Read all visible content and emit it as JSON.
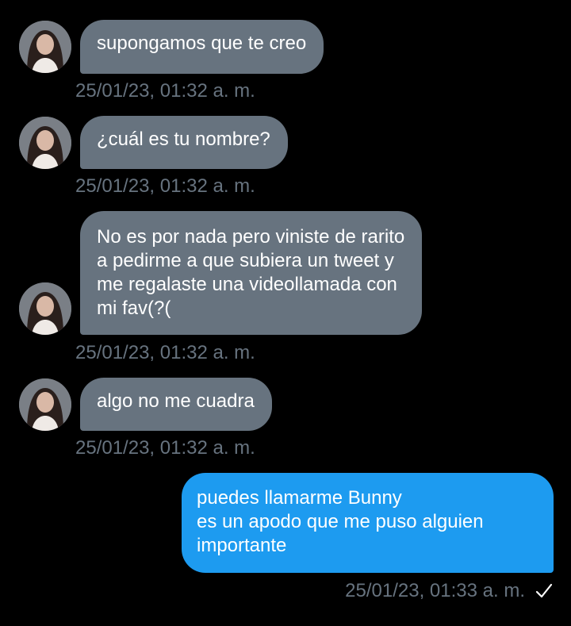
{
  "messages": [
    {
      "direction": "in",
      "text": "supongamos que te creo",
      "timestamp": "25/01/23, 01:32 a. m."
    },
    {
      "direction": "in",
      "text": "¿cuál es tu nombre?",
      "timestamp": "25/01/23, 01:32 a. m."
    },
    {
      "direction": "in",
      "text": "No es por nada pero viniste de rarito\na pedirme a que subiera un tweet y\nme regalaste una videollamada con\nmi fav(?(",
      "timestamp": "25/01/23, 01:32 a. m."
    },
    {
      "direction": "in",
      "text": "algo no me cuadra",
      "timestamp": "25/01/23, 01:32 a. m."
    },
    {
      "direction": "out",
      "text": "puedes llamarme Bunny\nes un apodo que me puso alguien\nimportante",
      "timestamp": "25/01/23, 01:33 a. m.",
      "status_icon": "sent-check-icon"
    }
  ],
  "colors": {
    "background": "#000000",
    "incoming_bubble": "#67737f",
    "outgoing_bubble": "#1d9bf0",
    "timestamp": "#67737f",
    "text": "#ffffff"
  },
  "icons": {
    "avatar": "user-avatar-photo"
  }
}
